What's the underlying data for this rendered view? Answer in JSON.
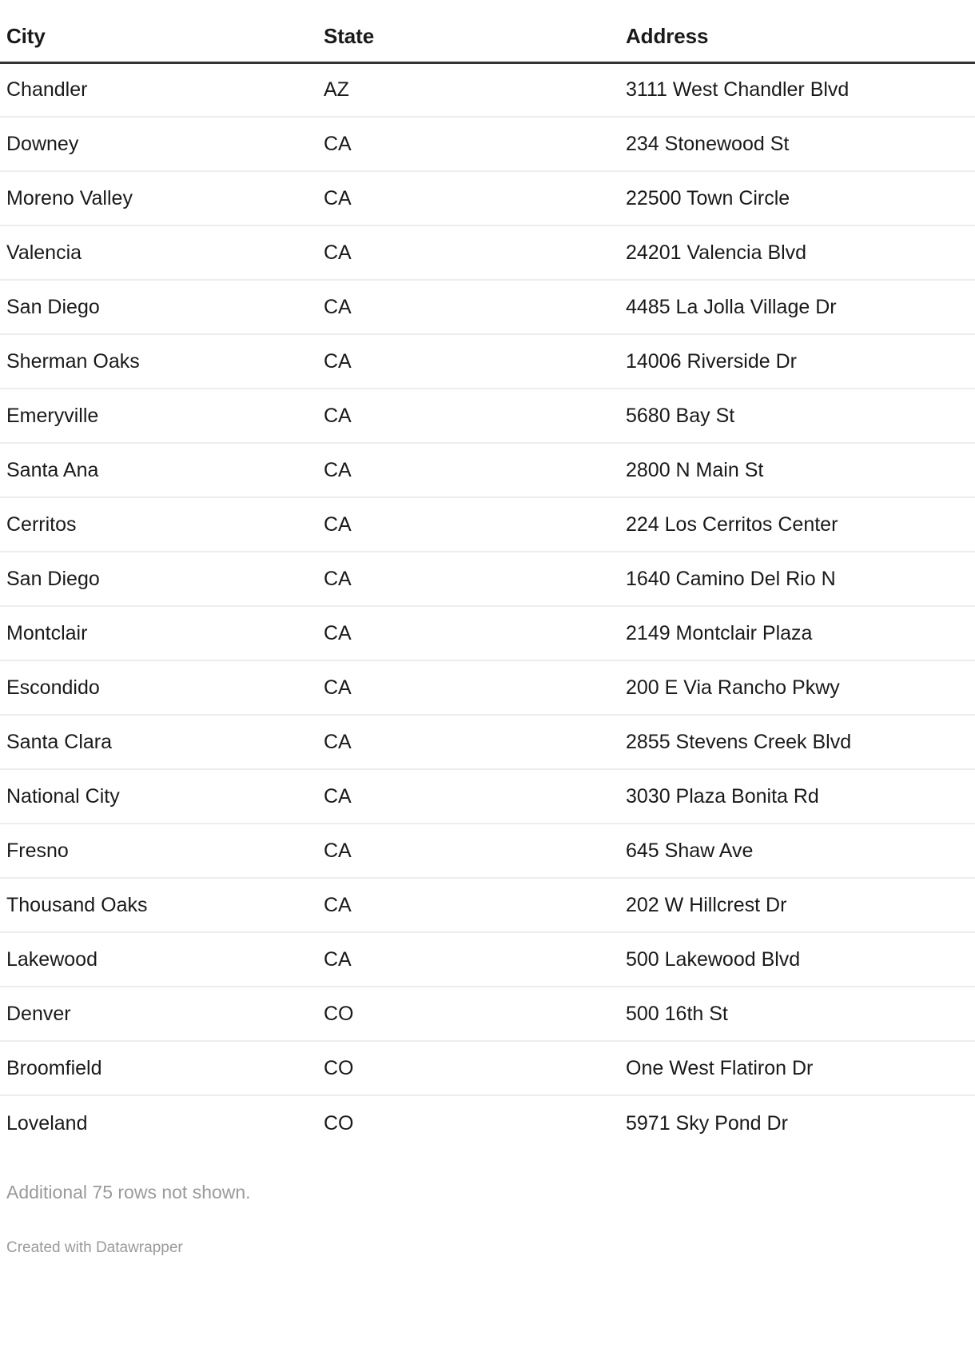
{
  "table": {
    "columns": [
      "City",
      "State",
      "Address"
    ],
    "rows": [
      [
        "Chandler",
        "AZ",
        "3111 West Chandler Blvd"
      ],
      [
        "Downey",
        "CA",
        "234 Stonewood St"
      ],
      [
        "Moreno Valley",
        "CA",
        "22500 Town Circle"
      ],
      [
        "Valencia",
        "CA",
        "24201 Valencia Blvd"
      ],
      [
        "San Diego",
        "CA",
        "4485 La Jolla Village Dr"
      ],
      [
        "Sherman Oaks",
        "CA",
        "14006 Riverside Dr"
      ],
      [
        "Emeryville",
        "CA",
        "5680 Bay St"
      ],
      [
        "Santa Ana",
        "CA",
        "2800 N Main St"
      ],
      [
        "Cerritos",
        "CA",
        "224 Los Cerritos Center"
      ],
      [
        "San Diego",
        "CA",
        "1640 Camino Del Rio N"
      ],
      [
        "Montclair",
        "CA",
        "2149 Montclair Plaza"
      ],
      [
        "Escondido",
        "CA",
        "200 E Via Rancho Pkwy"
      ],
      [
        "Santa Clara",
        "CA",
        "2855 Stevens Creek Blvd"
      ],
      [
        "National City",
        "CA",
        "3030 Plaza Bonita Rd"
      ],
      [
        "Fresno",
        "CA",
        "645 Shaw Ave"
      ],
      [
        "Thousand Oaks",
        "CA",
        "202 W Hillcrest Dr"
      ],
      [
        "Lakewood",
        "CA",
        "500 Lakewood Blvd"
      ],
      [
        "Denver",
        "CO",
        "500 16th St"
      ],
      [
        "Broomfield",
        "CO",
        "One West Flatiron Dr"
      ],
      [
        "Loveland",
        "CO",
        "5971 Sky Pond Dr"
      ]
    ]
  },
  "footer": {
    "rows_not_shown": "Additional 75 rows not shown.",
    "credit": "Created with Datawrapper"
  },
  "colors": {
    "text": "#1a1a1a",
    "header_rule": "#333333",
    "row_rule": "#ededed",
    "muted_text": "#9a9a9a",
    "background": "#ffffff"
  }
}
